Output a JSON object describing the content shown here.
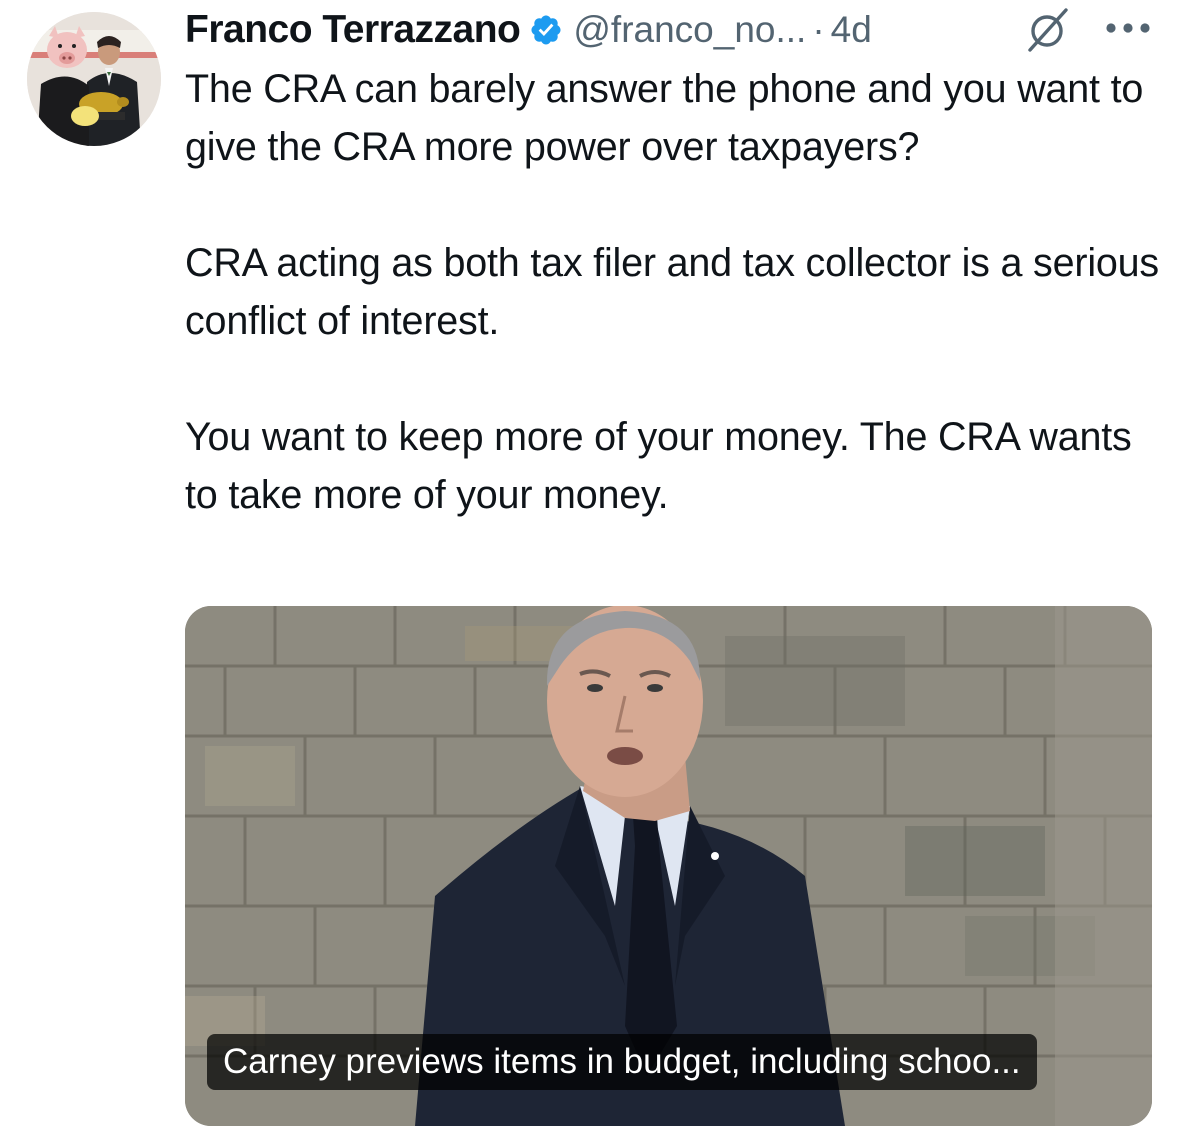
{
  "post": {
    "author": {
      "display_name": "Franco Terrazzano",
      "handle": "@franco_no...",
      "separator": "·",
      "time_ago": "4d",
      "verified": true
    },
    "text": {
      "paragraph_1": "The CRA can barely answer the phone and you want to give the CRA more power over taxpayers?",
      "paragraph_2": "CRA acting as both tax filer and tax collector is a serious conflict of interest.",
      "paragraph_3": "You want to keep more of your money. The CRA wants to take more of your money."
    },
    "media": {
      "caption": "Carney previews items in budget, including schoo..."
    }
  },
  "icons": {
    "verified": "verified-badge-icon",
    "grok": "grok-icon",
    "more": "more-options-icon"
  },
  "colors": {
    "text_primary": "#0f1419",
    "text_secondary": "#536471",
    "verified_blue": "#1d9bf0",
    "caption_bg": "rgba(0,0,0,0.72)"
  }
}
